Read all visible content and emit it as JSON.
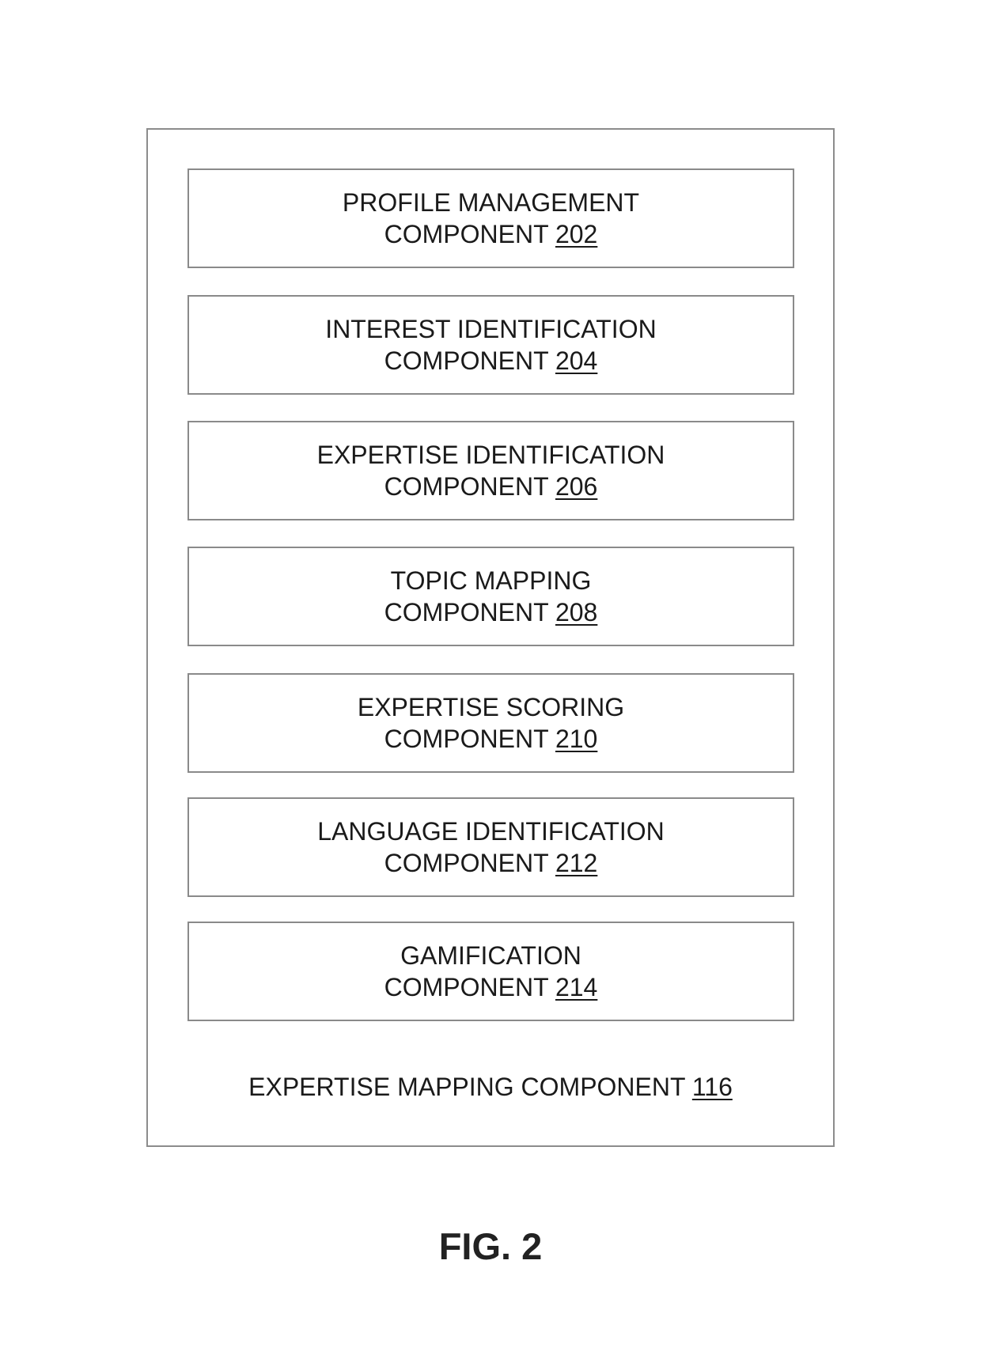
{
  "diagram": {
    "container": {
      "label": "EXPERTISE MAPPING COMPONENT",
      "ref": "116"
    },
    "components": [
      {
        "line1": "PROFILE MANAGEMENT",
        "line2": "COMPONENT",
        "ref": "202"
      },
      {
        "line1": "INTEREST IDENTIFICATION",
        "line2": "COMPONENT",
        "ref": "204"
      },
      {
        "line1": "EXPERTISE IDENTIFICATION",
        "line2": "COMPONENT",
        "ref": "206"
      },
      {
        "line1": "TOPIC MAPPING",
        "line2": "COMPONENT",
        "ref": "208"
      },
      {
        "line1": "EXPERTISE SCORING",
        "line2": "COMPONENT",
        "ref": "210"
      },
      {
        "line1": "LANGUAGE IDENTIFICATION",
        "line2": "COMPONENT",
        "ref": "212"
      },
      {
        "line1": "GAMIFICATION",
        "line2": "COMPONENT",
        "ref": "214"
      }
    ],
    "figure_label": "FIG. 2"
  }
}
